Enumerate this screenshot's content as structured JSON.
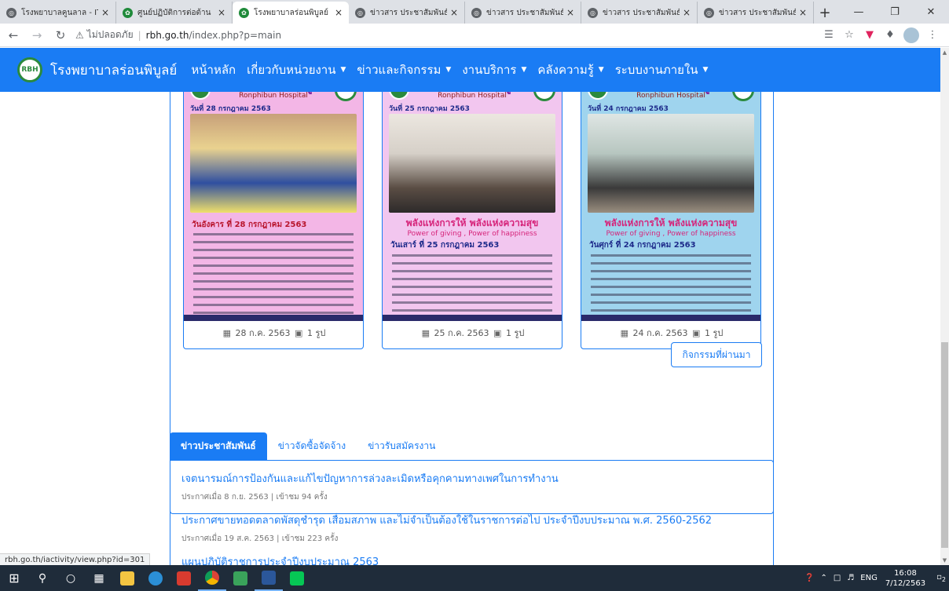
{
  "browser": {
    "tabs": [
      {
        "title": "โรงพยาบาลคูนลาล - IT",
        "icon": "globe-icon",
        "active": false
      },
      {
        "title": "ศูนย์ปฏิบัติการต่อต้าน",
        "icon": "green-emblem-icon",
        "active": false
      },
      {
        "title": "โรงพยาบาลร่อนพิบูลย์",
        "icon": "green-emblem-icon",
        "active": true
      },
      {
        "title": "ข่าวสาร ประชาสัมพันธ์",
        "icon": "globe-icon",
        "active": false
      },
      {
        "title": "ข่าวสาร ประชาสัมพันธ์",
        "icon": "globe-icon",
        "active": false
      },
      {
        "title": "ข่าวสาร ประชาสัมพันธ์",
        "icon": "globe-icon",
        "active": false
      },
      {
        "title": "ข่าวสาร ประชาสัมพันธ์",
        "icon": "globe-icon",
        "active": false
      }
    ],
    "new_tab": "+",
    "insecure_label": "ไม่ปลอดภัย",
    "url_host": "rbh.go.th",
    "url_path": "/index.php?p=main",
    "status_url": "rbh.go.th/iactivity/view.php?id=301"
  },
  "site": {
    "brand": "โรงพยาบาลร่อนพิบูลย์",
    "logo_text": "RBH",
    "nav": [
      {
        "label": "หน้าหลัก",
        "dropdown": false
      },
      {
        "label": "เกี่ยวกับหน่วยงาน",
        "dropdown": true
      },
      {
        "label": "ข่าวและกิจกรรม",
        "dropdown": true
      },
      {
        "label": "งานบริการ",
        "dropdown": true
      },
      {
        "label": "คลังความรู้",
        "dropdown": true
      },
      {
        "label": "ระบบงานภายใน",
        "dropdown": true
      }
    ],
    "accent": "#1a7cf4"
  },
  "activities": {
    "cards": [
      {
        "poster_title": "โรงพยาบาลร่อนพิบูลย์",
        "poster_sub": "Ronphibun Hospital",
        "poster_date": "วันที่ 28 กรกฎาคม 2563",
        "poster_day": "วันอังคาร ที่ 28 กรกฎาคม 2563",
        "slogan": "",
        "slogan_en": "",
        "bg": "#f3b6e6",
        "date": "28 ก.ค. 2563",
        "photos": "1 รูป"
      },
      {
        "poster_title": "โรงพยาบาลร่อนพิบูลย์",
        "poster_sub": "Ronphibun Hospital",
        "poster_date": "วันที่ 25 กรกฎาคม 2563",
        "poster_day": "วันเสาร์ ที่ 25 กรกฎาคม 2563",
        "slogan": "พลังแห่งการให้ พลังแห่งความสุข",
        "slogan_en": "Power of giving , Power of happiness",
        "bg": "#f2c6ef",
        "date": "25 ก.ค. 2563",
        "photos": "1 รูป"
      },
      {
        "poster_title": "โรงพยาบาลร่อนพิบูลย์",
        "poster_sub": "Ronphibun Hospital",
        "poster_date": "วันที่ 24 กรกฎาคม 2563",
        "poster_day": "วันศุกร์ ที่ 24 กรกฎาคม 2563",
        "slogan": "พลังแห่งการให้ พลังแห่งความสุข",
        "slogan_en": "Power of giving , Power of happiness",
        "bg": "#9fd4ee",
        "date": "24 ก.ค. 2563",
        "photos": "1 รูป"
      }
    ],
    "more_label": "กิจกรรมที่ผ่านมา"
  },
  "news": {
    "tabs": [
      "ข่าวประชาสัมพันธ์",
      "ข่าวจัดซื้อจัดจ้าง",
      "ข่าวรับสมัครงาน"
    ],
    "items": [
      {
        "title": "เจตนารมณ์การป้องกันและแก้ไขปัญหาการล่วงละเมิดหรือคุกคามทางเพศในการทำงาน",
        "meta": "ประกาศเมื่อ 8 ก.ย. 2563 | เข้าชม 94 ครั้ง"
      },
      {
        "title": "ประกาศขายทอดตลาดพัสดุชำรุด เสื่อมสภาพ และไม่จำเป็นต้องใช้ในราชการต่อไป ประจำปีงบประมาณ พ.ศ. 2560-2562",
        "meta": "ประกาศเมื่อ 19 ส.ค. 2563 | เข้าชม 223 ครั้ง"
      },
      {
        "title": "แผนปฏิบัติราชการประจำปีงบประมาณ 2563",
        "meta": ""
      }
    ]
  },
  "taskbar": {
    "lang": "ENG",
    "time": "16:08",
    "date": "7/12/2563",
    "notif_count": "2"
  }
}
